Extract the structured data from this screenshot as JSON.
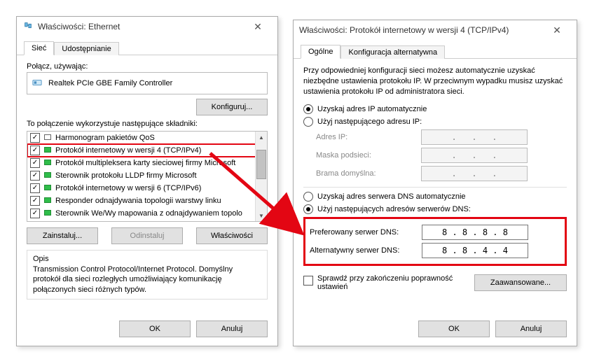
{
  "left": {
    "title": "Właściwości: Ethernet",
    "tabs": {
      "siec": "Sieć",
      "udost": "Udostępnianie"
    },
    "connect_label": "Połącz, używając:",
    "adapter": "Realtek PCIe GBE Family Controller",
    "configure_btn": "Konfiguruj...",
    "components_label": "To połączenie wykorzystuje następujące składniki:",
    "items": [
      "Harmonogram pakietów QoS",
      "Protokół internetowy w wersji 4 (TCP/IPv4)",
      "Protokół multipleksera karty sieciowej firmy Microsoft",
      "Sterownik protokołu LLDP firmy Microsoft",
      "Protokół internetowy w wersji 6 (TCP/IPv6)",
      "Responder odnajdywania topologii warstwy linku",
      "Sterownik We/Wy mapowania z odnajdywaniem topolo"
    ],
    "install_btn": "Zainstaluj...",
    "uninstall_btn": "Odinstaluj",
    "props_btn": "Właściwości",
    "desc_title": "Opis",
    "desc_text": "Transmission Control Protocol/Internet Protocol. Domyślny protokół dla sieci rozległych umożliwiający komunikację połączonych sieci różnych typów.",
    "ok": "OK",
    "cancel": "Anuluj"
  },
  "right": {
    "title": "Właściwości: Protokół internetowy w wersji 4 (TCP/IPv4)",
    "tabs": {
      "general": "Ogólne",
      "alt": "Konfiguracja alternatywna"
    },
    "intro": "Przy odpowiedniej konfiguracji sieci możesz automatycznie uzyskać niezbędne ustawienia protokołu IP. W przeciwnym wypadku musisz uzyskać ustawienia protokołu IP od administratora sieci.",
    "ip_auto": "Uzyskaj adres IP automatycznie",
    "ip_manual": "Użyj następującego adresu IP:",
    "ip_label": "Adres IP:",
    "mask_label": "Maska podsieci:",
    "gw_label": "Brama domyślna:",
    "dns_auto": "Uzyskaj adres serwera DNS automatycznie",
    "dns_manual": "Użyj następujących adresów serwerów DNS:",
    "dns_pref_label": "Preferowany serwer DNS:",
    "dns_alt_label": "Alternatywny serwer DNS:",
    "dns_pref_value": "8 . 8 . 8 . 8",
    "dns_alt_value": "8 . 8 . 4 . 4",
    "validate": "Sprawdź przy zakończeniu poprawność ustawień",
    "advanced": "Zaawansowane...",
    "ok": "OK",
    "cancel": "Anuluj"
  }
}
